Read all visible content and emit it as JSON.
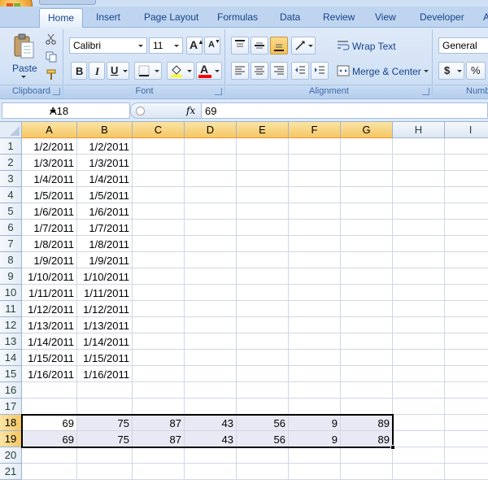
{
  "ribbon": {
    "tabs": [
      "Home",
      "Insert",
      "Page Layout",
      "Formulas",
      "Data",
      "Review",
      "View",
      "Developer",
      "A"
    ],
    "active_tab": "Home",
    "clipboard": {
      "paste_label": "Paste",
      "group_label": "Clipboard"
    },
    "font": {
      "font_name": "Calibri",
      "font_size": "11",
      "grow_label": "A",
      "shrink_label": "A",
      "bold": "B",
      "italic": "I",
      "underline": "U",
      "font_color_label": "A",
      "group_label": "Font"
    },
    "alignment": {
      "wrap_text": "Wrap Text",
      "merge_center": "Merge & Center",
      "group_label": "Alignment"
    },
    "number": {
      "format": "General",
      "currency": "$",
      "percent": "%",
      "group_label": "Numb"
    }
  },
  "formula_bar": {
    "name_box": "A18",
    "fx": "fx",
    "value": "69"
  },
  "sheet": {
    "columns": [
      "A",
      "B",
      "C",
      "D",
      "E",
      "F",
      "G",
      "H",
      "I"
    ],
    "selected_columns": [
      "A",
      "B",
      "C",
      "D",
      "E",
      "F",
      "G"
    ],
    "rows": [
      "1",
      "2",
      "3",
      "4",
      "5",
      "6",
      "7",
      "8",
      "9",
      "10",
      "11",
      "12",
      "13",
      "14",
      "15",
      "16",
      "17",
      "18",
      "19",
      "20",
      "21"
    ],
    "selected_rows": [
      "18",
      "19"
    ],
    "cells": [
      [
        "1/2/2011",
        "1/2/2011"
      ],
      [
        "1/3/2011",
        "1/3/2011"
      ],
      [
        "1/4/2011",
        "1/4/2011"
      ],
      [
        "1/5/2011",
        "1/5/2011"
      ],
      [
        "1/6/2011",
        "1/6/2011"
      ],
      [
        "1/7/2011",
        "1/7/2011"
      ],
      [
        "1/8/2011",
        "1/8/2011"
      ],
      [
        "1/9/2011",
        "1/9/2011"
      ],
      [
        "1/10/2011",
        "1/10/2011"
      ],
      [
        "1/11/2011",
        "1/11/2011"
      ],
      [
        "1/12/2011",
        "1/12/2011"
      ],
      [
        "1/13/2011",
        "1/13/2011"
      ],
      [
        "1/14/2011",
        "1/14/2011"
      ],
      [
        "1/15/2011",
        "1/15/2011"
      ],
      [
        "1/16/2011",
        "1/16/2011"
      ],
      [],
      [],
      [
        "69",
        "75",
        "87",
        "43",
        "56",
        "9",
        "89"
      ],
      [
        "69",
        "75",
        "87",
        "43",
        "56",
        "9",
        "89"
      ],
      [],
      []
    ],
    "active_cell": "A18",
    "selection_range": "A18:G19"
  },
  "colors": {
    "ribbon_bg": "#dfeaf8",
    "header_selected": "#f5c765",
    "selection_fill": "#e8e9f4"
  }
}
